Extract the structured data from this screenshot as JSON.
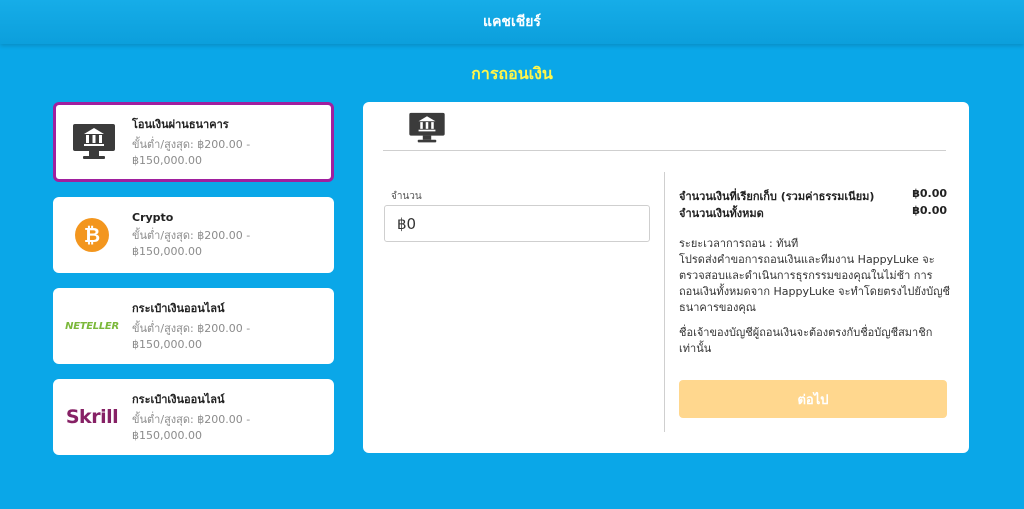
{
  "header": {
    "title": "แคชเชียร์"
  },
  "page": {
    "title": "การถอนเงิน"
  },
  "methods": [
    {
      "name": "โอนเงินผ่านธนาคาร",
      "limit": "ขั้นต่ำ/สูงสุด: ฿200.00 - ฿150,000.00",
      "icon": "bank-monitor-icon",
      "selected": true
    },
    {
      "name": "Crypto",
      "limit": "ขั้นต่ำ/สูงสุด: ฿200.00 - ฿150,000.00",
      "icon": "bitcoin-icon"
    },
    {
      "name": "กระเป๋าเงินออนไลน์",
      "limit": "ขั้นต่ำ/สูงสุด: ฿200.00 - ฿150,000.00",
      "logo_text": "NETELLER",
      "icon": "neteller-logo"
    },
    {
      "name": "กระเป๋าเงินออนไลน์",
      "limit": "ขั้นต่ำ/สูงสุด: ฿200.00 - ฿150,000.00",
      "logo_text": "Skrill",
      "icon": "skrill-logo"
    }
  ],
  "form": {
    "amount_label": "จำนวน",
    "amount_value": "฿0"
  },
  "summary": {
    "requested_label": "จำนวนเงินที่เรียกเก็บ (รวมค่าธรรมเนียม)",
    "requested_value": "฿0.00",
    "total_label": "จำนวนเงินทั้งหมด",
    "total_value": "฿0.00",
    "note1": "ระยะเวลาการถอน : ทันที\nโปรดส่งคำขอการถอนเงินและทีมงาน HappyLuke จะตรวจสอบและดำเนินการธุรกรรมของคุณในไม่ช้า การถอนเงินทั้งหมดจาก HappyLuke จะทำโดยตรงไปยังบัญชีธนาคารของคุณ",
    "note2": "ชื่อเจ้าของบัญชีผู้ถอนเงินจะต้องตรงกับชื่อบัญชีสมาชิกเท่านั้น",
    "next_label": "ต่อไป"
  },
  "colors": {
    "background": "#0aa7e8",
    "title_accent": "#fff64a",
    "selected_border": "#a11f9e",
    "button_disabled": "#ffd78e",
    "bitcoin": "#f3961e",
    "neteller": "#7bb83a",
    "skrill": "#862165"
  }
}
